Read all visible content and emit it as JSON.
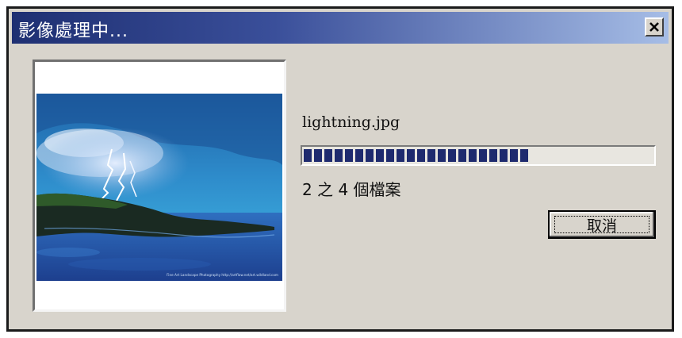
{
  "window": {
    "title": "影像處理中..."
  },
  "preview": {
    "image_name": "lightning-photo",
    "watermark": "Fine Art Landscape Photography http://artflow.net/art.wildland.com"
  },
  "progress": {
    "filename": "lightning.jpg",
    "percent": 66,
    "file_count_text": "2 之 4 個檔案"
  },
  "buttons": {
    "cancel_label": "取消"
  },
  "colors": {
    "title_gradient_start": "#1e2f72",
    "title_gradient_end": "#a6bde6",
    "progress_block": "#1e2a6e",
    "dialog_background": "#d8d4cc"
  }
}
